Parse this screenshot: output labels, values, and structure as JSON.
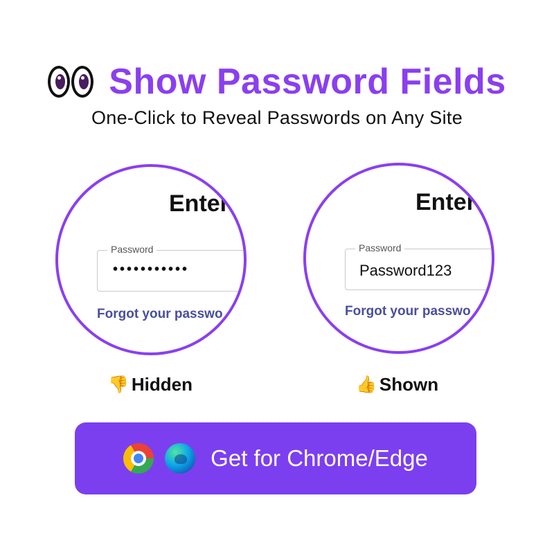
{
  "header": {
    "title": "Show Password Fields",
    "subtitle": "One-Click to Reveal Passwords on Any Site",
    "logo_icon": "eyes-icon"
  },
  "panels": {
    "hidden": {
      "heading": "Enter",
      "field_label": "Password",
      "field_value": "•••••••••••",
      "link_text": "Forgot your passwo",
      "caption": "Hidden",
      "caption_icon": "thumbs-down-icon"
    },
    "shown": {
      "heading": "Enter",
      "field_label": "Password",
      "field_value": "Password123",
      "link_text": "Forgot your passwo",
      "caption": "Shown",
      "caption_icon": "thumbs-up-icon"
    }
  },
  "cta": {
    "label": "Get for Chrome/Edge",
    "icons": [
      "chrome-icon",
      "edge-icon"
    ]
  },
  "colors": {
    "accent": "#8a3ff0",
    "button": "#7b3ff0",
    "link": "#4a4f9d"
  }
}
